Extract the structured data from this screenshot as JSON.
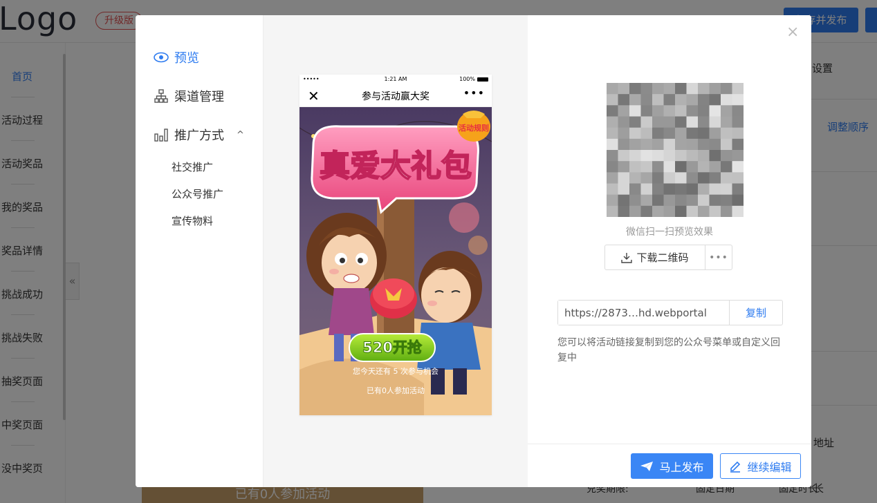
{
  "background": {
    "logo": "Logo",
    "upgrade_badge": "升级版",
    "publish_button": "保存并发布",
    "sidebar": [
      {
        "label": "首页",
        "active": true
      },
      {
        "label": "活动过程"
      },
      {
        "label": "活动奖品"
      },
      {
        "label": "我的奖品"
      },
      {
        "label": "奖品详情"
      },
      {
        "label": "挑战成功"
      },
      {
        "label": "挑战失败"
      },
      {
        "label": "抽奖页面"
      },
      {
        "label": "中奖页面"
      },
      {
        "label": "没中奖页"
      }
    ],
    "collapse_icon": "«",
    "right_items": {
      "settings": "设置",
      "adjust_order": "调整顺序",
      "address": "地址",
      "duration": "长",
      "limit_label": "兑奖期限:",
      "fixed_date": "固定日期",
      "fixed_length": "固定时长"
    },
    "bottom_preview_text": "已有0人参加活动"
  },
  "modal": {
    "nav": {
      "preview": "预览",
      "channel": "渠道管理",
      "promotion": "推广方式",
      "promotion_chevron": "^",
      "sub_items": [
        "社交推广",
        "公众号推广",
        "宣传物料"
      ]
    },
    "phone": {
      "status_dots": "•••••",
      "time": "1:21 AM",
      "battery": "100%",
      "close": "✕",
      "title": "参与活动赢大奖",
      "more": "•••",
      "badge": "活动规则",
      "banner": "真爱大礼包",
      "start_button": "520开抢",
      "chance_text": "您今天还有 5 次参与机会",
      "joined_text": "已有0人参加活动"
    },
    "qr_caption": "微信扫一扫预览效果",
    "download_label": "下载二维码",
    "download_more": "•••",
    "url_value": "https://2873…hd.webportal",
    "copy_label": "复制",
    "url_tip": "您可以将活动链接复制到您的公众号菜单或自定义回复中",
    "close": "×",
    "publish_now": "马上发布",
    "continue_edit": "继续编辑"
  },
  "colors": {
    "accent": "#2f7cf0",
    "overlay": "rgba(0,0,0,0.5)"
  }
}
